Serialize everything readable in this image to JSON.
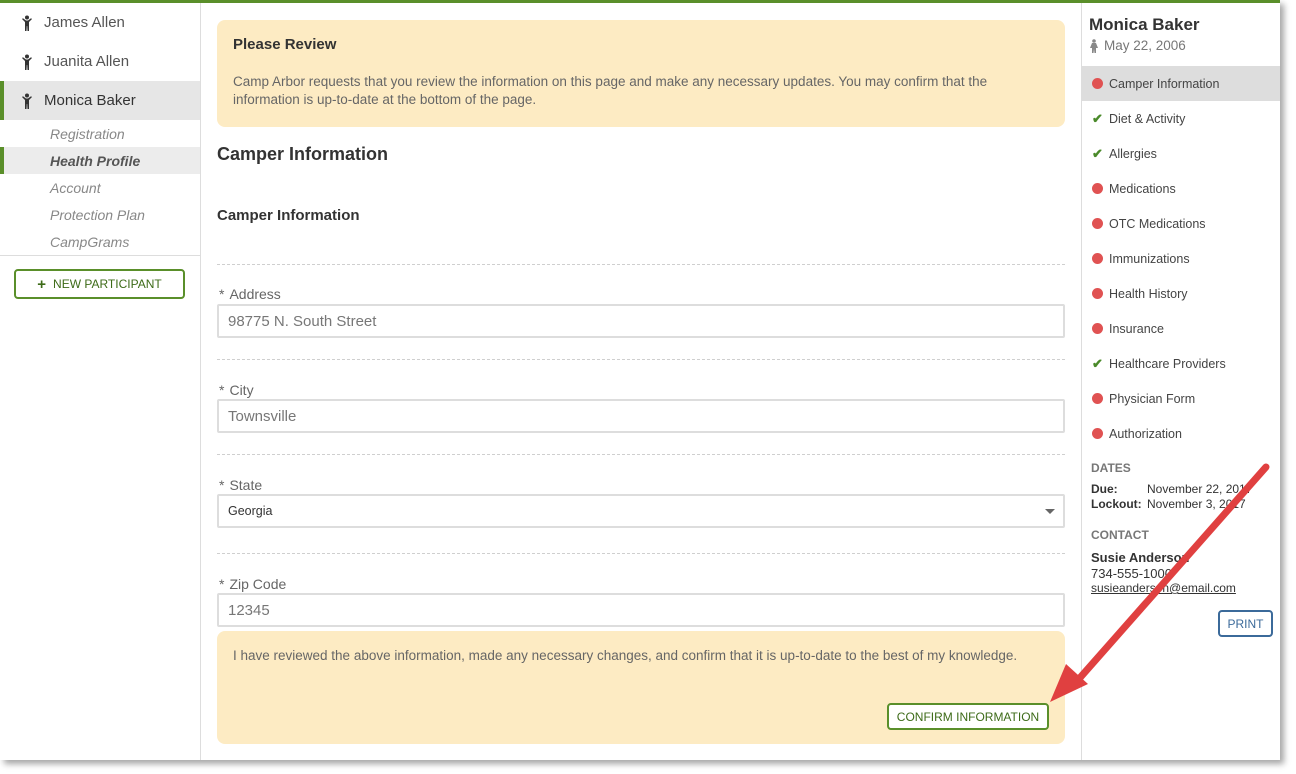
{
  "participants": [
    {
      "name": "James Allen"
    },
    {
      "name": "Juanita Allen"
    },
    {
      "name": "Monica Baker"
    }
  ],
  "subnav": [
    "Registration",
    "Health Profile",
    "Account",
    "Protection Plan",
    "CampGrams"
  ],
  "new_participant_label": "NEW PARTICIPANT",
  "notice": {
    "title": "Please Review",
    "text": "Camp Arbor requests that you review the information on this page and make any necessary updates. You may confirm that the information is up-to-date at the bottom of the page."
  },
  "page_title": "Camper Information",
  "section_title": "Camper Information",
  "fields": {
    "address": {
      "label": "Address",
      "value": "98775 N. South Street"
    },
    "city": {
      "label": "City",
      "value": "Townsville"
    },
    "state": {
      "label": "State",
      "value": "Georgia"
    },
    "zip": {
      "label": "Zip Code",
      "value": "12345"
    },
    "required_mark": "*"
  },
  "confirm": {
    "text": "I have reviewed the above information, made any necessary changes, and confirm that it is up-to-date to the best of my knowledge.",
    "button": "CONFIRM INFORMATION"
  },
  "right": {
    "name": "Monica Baker",
    "dob": "May 22, 2006",
    "nav": [
      {
        "label": "Camper Information",
        "status": "incomplete"
      },
      {
        "label": "Diet & Activity",
        "status": "complete"
      },
      {
        "label": "Allergies",
        "status": "complete"
      },
      {
        "label": "Medications",
        "status": "incomplete"
      },
      {
        "label": "OTC Medications",
        "status": "incomplete"
      },
      {
        "label": "Immunizations",
        "status": "incomplete"
      },
      {
        "label": "Health History",
        "status": "incomplete"
      },
      {
        "label": "Insurance",
        "status": "incomplete"
      },
      {
        "label": "Healthcare Providers",
        "status": "complete"
      },
      {
        "label": "Physician Form",
        "status": "incomplete"
      },
      {
        "label": "Authorization",
        "status": "incomplete"
      }
    ],
    "dates_title": "DATES",
    "due_label": "Due:",
    "due_value": "November 22, 2017",
    "lockout_label": "Lockout:",
    "lockout_value": "November 3, 2017",
    "contact_title": "CONTACT",
    "contact_name": "Susie Anderson",
    "contact_phone": "734-555-1000",
    "contact_email": "susieanderson@email.com",
    "print_label": "PRINT"
  },
  "colors": {
    "accent": "#5a8f2a",
    "notice_bg": "#fdebc3",
    "status_red": "#e05252",
    "arrow": "#e04040"
  }
}
